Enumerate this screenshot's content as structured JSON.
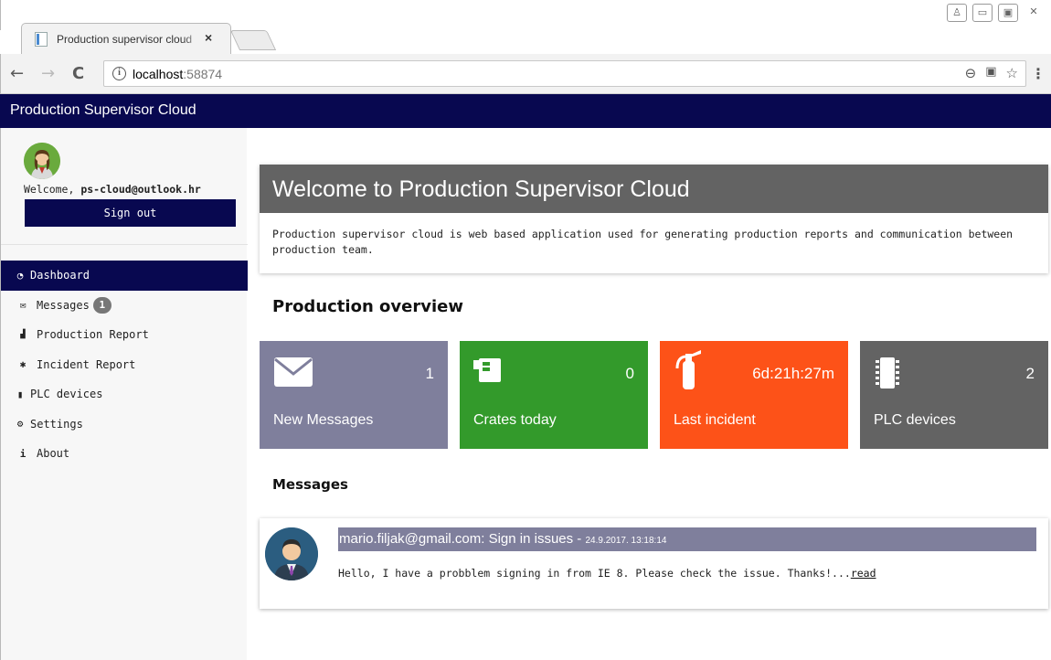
{
  "browser": {
    "tab_title": "Production supervisor cloud",
    "tab_close": "×",
    "url_host": "localhost",
    "url_port": ":58874",
    "window_controls": [
      "user",
      "minimize",
      "maximize",
      "close"
    ]
  },
  "app": {
    "brand": "Production Supervisor Cloud"
  },
  "sidebar": {
    "welcome_prefix": "Welcome, ",
    "user_email": "ps-cloud@outlook.hr",
    "signout_label": "Sign out",
    "items": [
      {
        "icon": "dashboard-icon",
        "label": "Dashboard",
        "active": true
      },
      {
        "icon": "envelope-icon",
        "label": "Messages",
        "badge": "1"
      },
      {
        "icon": "bar-chart-icon",
        "label": "Production Report"
      },
      {
        "icon": "bug-icon",
        "label": "Incident Report"
      },
      {
        "icon": "device-icon",
        "label": "PLC devices"
      },
      {
        "icon": "gear-icon",
        "label": "Settings"
      },
      {
        "icon": "info-icon",
        "label": "About"
      }
    ]
  },
  "welcome_panel": {
    "title": "Welcome to Production Supervisor Cloud",
    "body": "Production supervisor cloud is web based application used for generating production reports and communication between production team."
  },
  "overview": {
    "title": "Production overview",
    "tiles": [
      {
        "label": "New Messages",
        "value": "1",
        "icon": "envelope-icon",
        "color": "#7f7f9c"
      },
      {
        "label": "Crates today",
        "value": "0",
        "icon": "crate-icon",
        "color": "#339a2b"
      },
      {
        "label": "Last incident",
        "value": "6d:21h:27m",
        "icon": "fire-extinguisher-icon",
        "color": "#fd5218"
      },
      {
        "label": "PLC devices",
        "value": "2",
        "icon": "device-icon",
        "color": "#636363"
      }
    ]
  },
  "messages": {
    "title": "Messages",
    "items": [
      {
        "header": "mario.filjak@gmail.com: Sign in issues - ",
        "date": "24.9.2017. 13:18:14",
        "body": "Hello, I have a probblem signing in from IE 8. Please check the issue. Thanks!...",
        "read_label": "read"
      }
    ]
  },
  "colors": {
    "navy": "#080850",
    "header_gray": "#636363",
    "tile_purple": "#7f7f9c",
    "tile_green": "#339a2b",
    "tile_orange": "#fd5218"
  }
}
